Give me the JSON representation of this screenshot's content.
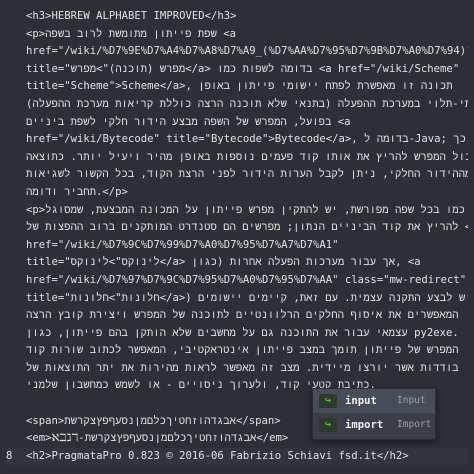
{
  "lines": [
    {
      "num": "",
      "text": "<h3>HEBREW ALPHABET IMPROVED</h3>",
      "rtl": false
    },
    {
      "num": "",
      "text": "<p>שפת פייתון מתומשת לרוב בשפה <a",
      "rtl": false
    },
    {
      "num": "",
      "text": "href=\"/wiki/%D7%9E%D7%A4%D7%A8%D7%A9_(%D7%AA%D7%95%D7%9B%D7%A0%D7%94)\"",
      "rtl": false
    },
    {
      "num": "",
      "text": "title=\"מפרש (תוכנה)\">מפרש</a> בדומה לשפות כמו <a href=\"/wiki/Scheme\"",
      "rtl": false
    },
    {
      "num": "",
      "text": "title=\"Scheme\">Scheme</a>, תכונה זו מאפשרת לפתח יישומי פייתון באופן",
      "rtl": false
    },
    {
      "num": "",
      "text": "(בלתי-תלוי במערכת ההפעלה (בתנאי שלא תוכנה הרצה כוללת קריאות מערכת ההפעלה",
      "rtl": false
    },
    {
      "num": "",
      "text": "בפועל, המפרש של השפה מבצע הידור חלקי לשפת ביניים <a",
      "rtl": false
    },
    {
      "num": "",
      "text": "href=\"/wiki/Bytecode\" title=\"Bytecode\">Bytecode</a>, בדומה ל-Java; כך",
      "rtl": false
    },
    {
      "num": "",
      "text": "יכול המפרש להריץ את אותו קוד פעמים נוספות באופן מהיר ויעיל יותר. כתוצאה",
      "rtl": false
    },
    {
      "num": "",
      "text": "מההידור החלקי, ניתן לקבל הערות הידור לפני הרצת הקוד, בכל הקשור לשגיאות",
      "rtl": false
    },
    {
      "num": "",
      "text": "תחביר ודומה.</p>",
      "rtl": false
    },
    {
      "num": "",
      "text": "<p>כמו בכל שפה מפורשת, יש להתקין מפרש פייתון על המכונה המבצעת, שמסוגל",
      "rtl": false
    },
    {
      "num": "",
      "text": "להריץ את קוד הביניים הנתון; מפרשים הם סטנדרט המותקנים ברוב ההפצות של <a",
      "rtl": false
    },
    {
      "num": "",
      "text": "href=\"/wiki/%D7%9C%D7%99%D7%A0%D7%95%D7%A7%D7%A1\"",
      "rtl": false
    },
    {
      "num": "",
      "text": "title=\"לינוקס\">לינוקס</a> אך עבור מערכות הפעלה אחרות (כגון, <a",
      "rtl": false
    },
    {
      "num": "",
      "text": "href=\"/wiki/%D7%97%D7%9C%D7%95%D7%A0%D7%95%D7%AA\" class=\"mw-redirect\"",
      "rtl": false
    },
    {
      "num": "",
      "text": "title=\"חלונות\">חלונות</a>) יש לבצע התקנה עצמית. עם זאת, קיימים יישומים",
      "rtl": false
    },
    {
      "num": "",
      "text": "המאפשרים את איסוף החלקים הרלוונטיים לתוכנה של המפרש ויצירת קובץ הרצה",
      "rtl": false
    },
    {
      "num": "",
      "text": "עצמאי עבור את התוכנה גם על מחשבים שלא הותקן בהם פייתון, כגון py2exe.",
      "rtl": false
    },
    {
      "num": "",
      "text": "המפרש של פייתון תומך במצב פייתון אינטראקטיבי, המאפשר לכתוב שורות קוד",
      "rtl": false
    },
    {
      "num": "",
      "text": "בודדות אשר יורצו מיידית. מצב זה מאפשר לראות מהירות את יתר התוצאות של",
      "rtl": false
    },
    {
      "num": "",
      "text": "כתיבת קטעי קוד, ולערוך ניסויים - או לשמש כמחשבון שלמני.",
      "rtl": false
    },
    {
      "num": "",
      "text": "",
      "rtl": false
    },
    {
      "num": "",
      "text": "<span>אבגדהוזחטיךכלםמןנסעףפץצקרשת</span>",
      "rtl": false
    },
    {
      "num": "",
      "text": "<em>ℵℶℷℸ-אבגדהוזחטיךכלםמןנסעףפץצקרשת</em>",
      "rtl": false
    },
    {
      "num": "8",
      "text": "<h2>PragmataPro 0.823 © 2016-06 Fabrizio Schiavi fsd.it</h2>",
      "rtl": false,
      "active": true
    }
  ],
  "autocomplete": {
    "items": [
      {
        "icon": "↪",
        "word": "input",
        "hint": "Input",
        "selected": true
      },
      {
        "icon": "↪",
        "word": "import",
        "hint": "Import",
        "selected": false
      }
    ]
  }
}
